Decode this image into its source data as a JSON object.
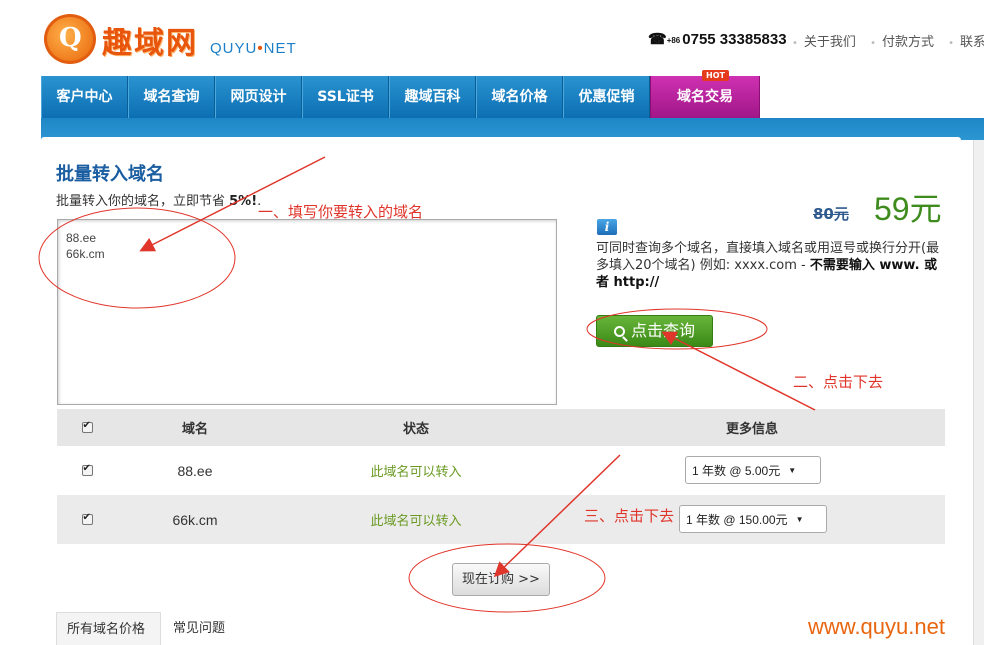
{
  "header": {
    "logo_mark": "Q",
    "logo_cn": "趣域网",
    "logo_en_a": "QUYU",
    "logo_en_dot": "•",
    "logo_en_b": "NET",
    "phone_prefix": "+86",
    "phone": "0755 33385833",
    "links": [
      "关于我们",
      "付款方式",
      "联系"
    ]
  },
  "nav": {
    "items": [
      "客户中心",
      "域名查询",
      "网页设计",
      "SSL证书",
      "趣域百科",
      "域名价格",
      "优惠促销",
      "域名交易"
    ],
    "active_index": 7,
    "hot_badge": "HOT"
  },
  "page": {
    "title": "批量转入域名",
    "subtitle_prefix": "批量转入你的域名，立即节省 ",
    "subtitle_bold": "5%!",
    "subtitle_suffix": "."
  },
  "domain_input": {
    "value": "88.ee\n66k.cm"
  },
  "pricing": {
    "old_price": "80元",
    "new_price": "59元"
  },
  "hint": {
    "icon": "i",
    "text": "可同时查询多个域名，直接填入域名或用逗号或换行分开(最多填入20个域名) 例如: xxxx.com - ",
    "bold": "不需要输入 www. 或者 http://"
  },
  "query_button": {
    "label": "点击查询"
  },
  "table": {
    "headers": {
      "domain": "域名",
      "status": "状态",
      "more": "更多信息"
    },
    "rows": [
      {
        "domain": "88.ee",
        "status": "此域名可以转入",
        "option": "1 年数 @ 5.00元"
      },
      {
        "domain": "66k.cm",
        "status": "此域名可以转入",
        "option": "1 年数 @ 150.00元"
      }
    ]
  },
  "order_button": {
    "label": "现在订购 >>"
  },
  "tabs": [
    "所有域名价格",
    "常见问题"
  ],
  "annotations": {
    "step1": "一、填写你要转入的域名",
    "step2": "二、点击下去",
    "step3": "三、点击下去"
  },
  "watermark": "www.quyu.net",
  "colors": {
    "nav_blue": "#0c6fb3",
    "nav_active": "#a01688",
    "price_green": "#3f8c1e",
    "status_green": "#6a9a23",
    "annotation_red": "#e0352a",
    "brand_orange": "#e8550c"
  }
}
